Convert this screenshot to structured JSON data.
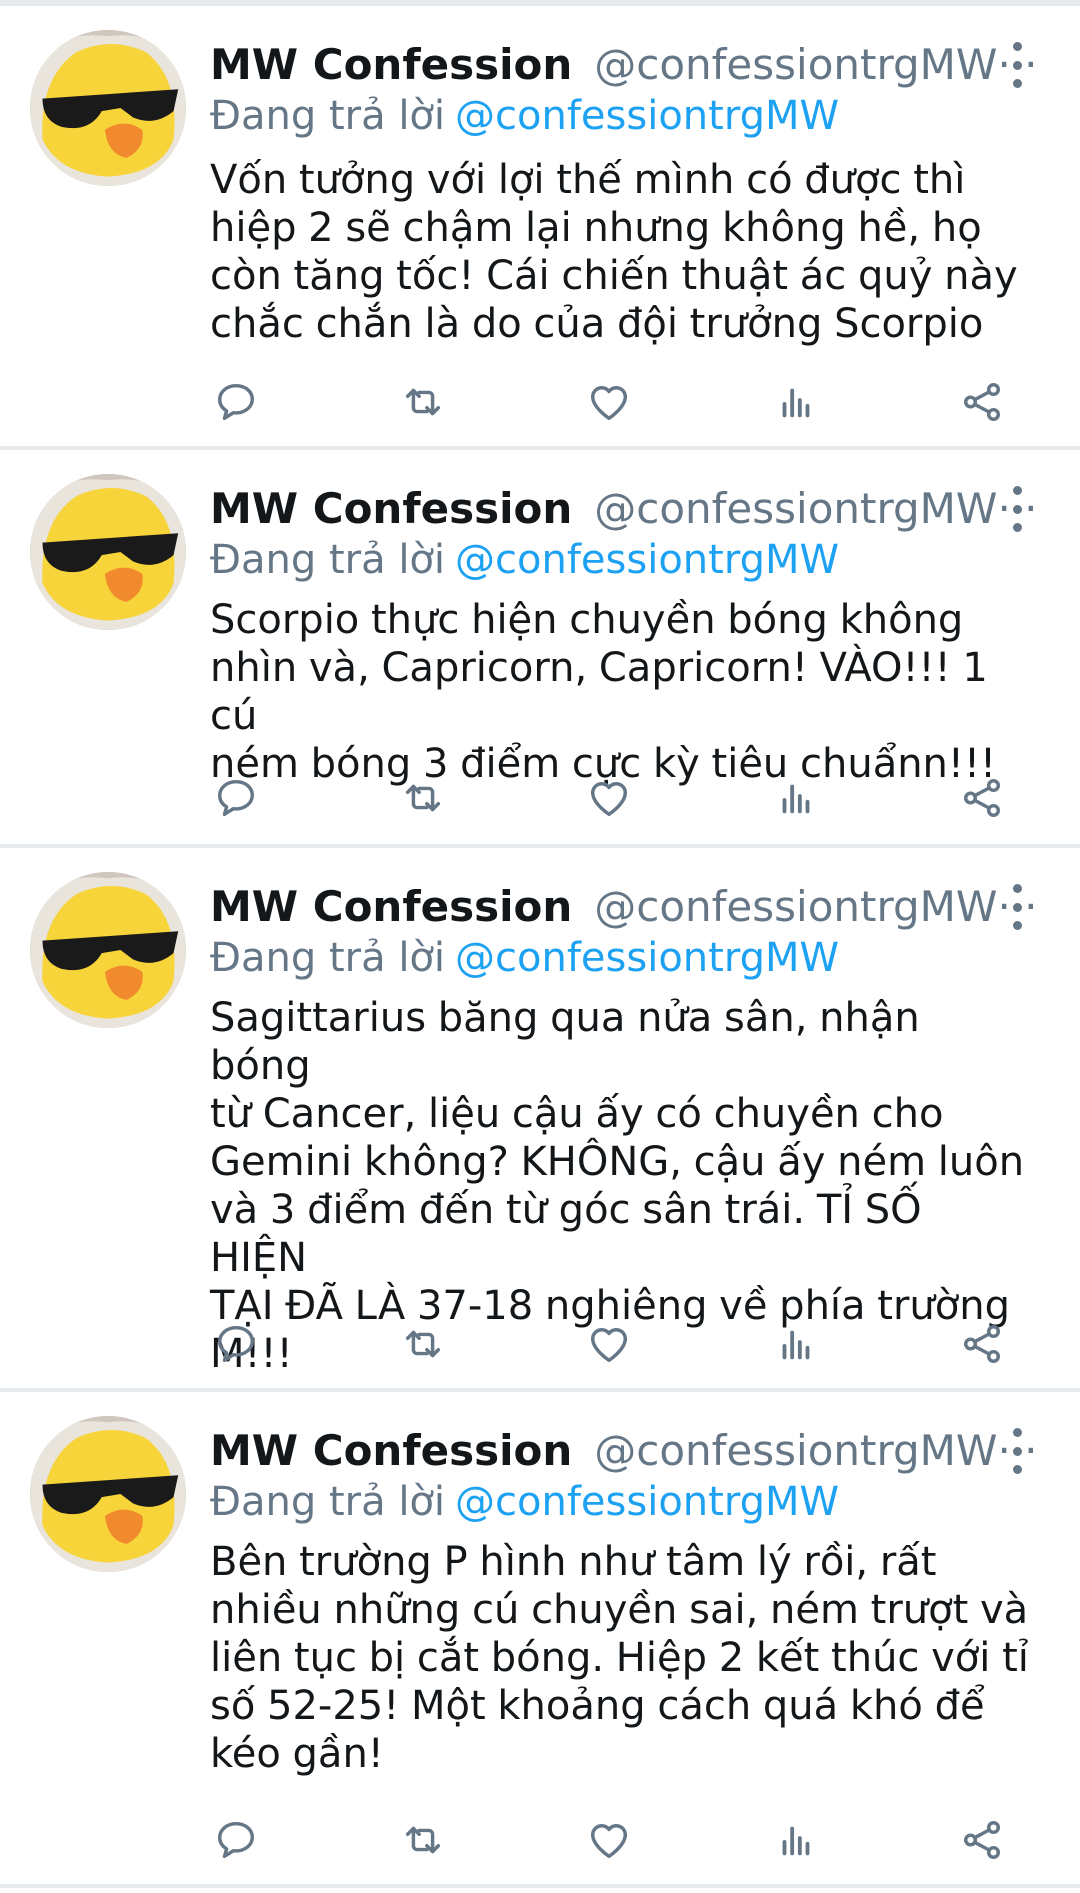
{
  "colors": {
    "name_text": "#14171a",
    "muted": "#657786",
    "link": "#1da1f2",
    "divider": "#e7eaed"
  },
  "reply_prefix": "Đang trả lời",
  "tweets": [
    {
      "author": "MW Confession",
      "handle": "@confessiontrgMW···",
      "reply_to": "@confessiontrgMW",
      "lines": [
        "Vốn tưởng với lợi thế mình có được thì",
        "hiệp 2 sẽ chậm lại nhưng không hề, họ",
        "còn tăng tốc! Cái chiến thuật ác quỷ này",
        "chắc chắn là do của đội trưởng Scorpio"
      ]
    },
    {
      "author": "MW Confession",
      "handle": "@confessiontrgMW···",
      "reply_to": "@confessiontrgMW",
      "lines": [
        "Scorpio thực hiện chuyền bóng không",
        "nhìn và, Capricorn, Capricorn! VÀO!!! 1 cú",
        "ném bóng 3 điểm cực kỳ tiêu chuẩnn!!!"
      ]
    },
    {
      "author": "MW Confession",
      "handle": "@confessiontrgMW···",
      "reply_to": "@confessiontrgMW",
      "lines": [
        "Sagittarius băng qua nửa sân, nhận bóng",
        "từ Cancer, liệu cậu ấy có chuyền cho",
        "Gemini không? KHÔNG, cậu ấy ném luôn",
        "và 3 điểm đến từ góc sân trái. TỈ SỐ HIỆN",
        "TẠI ĐÃ LÀ 37-18 nghiêng về phía trường",
        "M!!!"
      ]
    },
    {
      "author": "MW Confession",
      "handle": "@confessiontrgMW···",
      "reply_to": "@confessiontrgMW",
      "lines": [
        "Bên trường P hình như tâm lý rồi, rất",
        "nhiều những cú chuyền sai, ném trượt và",
        "liên tục bị cắt bóng. Hiệp 2 kết thúc với tỉ",
        "số 52-25! Một khoảng cách quá khó để",
        "kéo gần!"
      ]
    }
  ],
  "action_icons": [
    "reply-icon",
    "retweet-icon",
    "like-icon",
    "analytics-icon",
    "share-icon"
  ]
}
